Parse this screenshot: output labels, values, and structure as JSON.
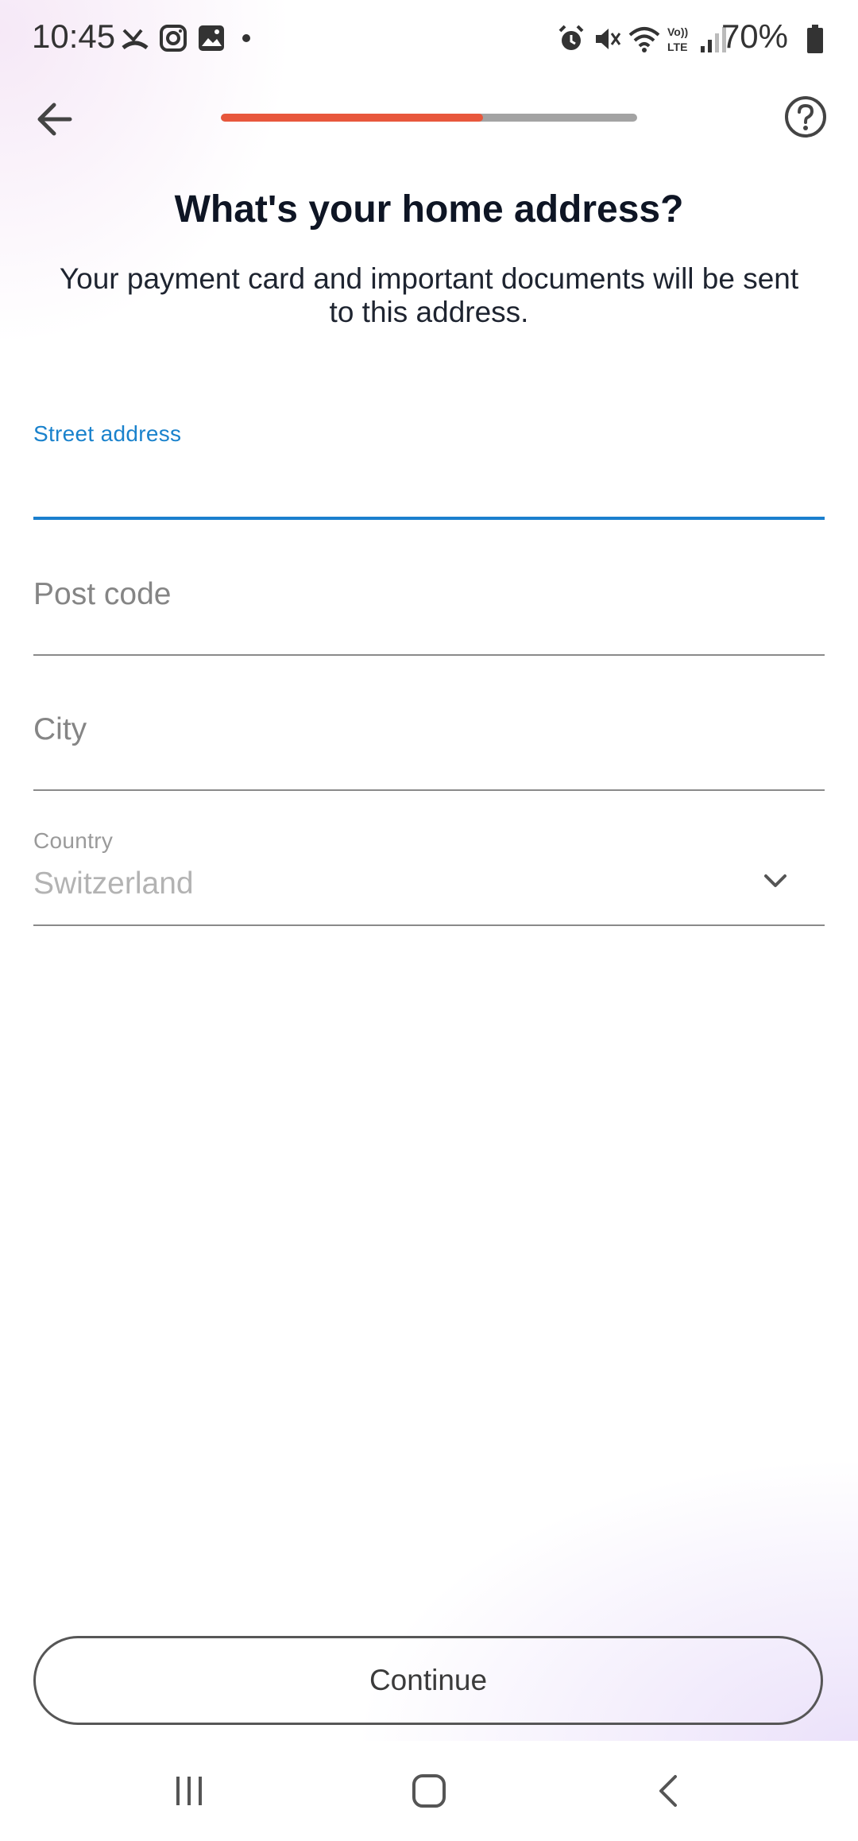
{
  "status_bar": {
    "time": "10:45",
    "battery_percent": "70%",
    "left_icons": [
      "missed-call-icon",
      "instagram-icon",
      "gallery-icon",
      "dot-icon"
    ],
    "right_icons": [
      "alarm-icon",
      "mute-icon",
      "wifi-icon",
      "volte-icon",
      "signal-icon",
      "battery-icon"
    ]
  },
  "header": {
    "progress_fraction": 0.63,
    "progress_color": "#e8573c",
    "track_color": "#a3a3a3"
  },
  "page": {
    "title": "What's your home address?",
    "subtitle": "Your payment card and important documents will be sent to this address."
  },
  "form": {
    "street": {
      "label": "Street address",
      "value": ""
    },
    "postcode": {
      "placeholder": "Post code"
    },
    "city": {
      "placeholder": "City"
    },
    "country": {
      "label": "Country",
      "value": "Switzerland"
    }
  },
  "actions": {
    "continue_label": "Continue"
  },
  "colors": {
    "accent": "#1b7fce",
    "primary_text": "#0e1524"
  }
}
